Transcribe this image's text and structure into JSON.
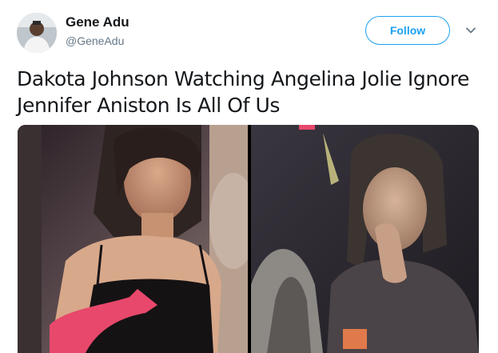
{
  "tweet": {
    "author": {
      "name": "Gene Adu",
      "handle": "@GeneAdu"
    },
    "follow_label": "Follow",
    "text": "Dakota Johnson Watching Angelina Jolie Ignore Jennifer Aniston Is All Of Us"
  },
  "icons": {
    "more": "chevron-down-icon",
    "avatar": "profile-photo"
  },
  "colors": {
    "accent": "#1da1f2",
    "text": "#14171a",
    "muted": "#657786",
    "arrow": "#e8486b"
  }
}
